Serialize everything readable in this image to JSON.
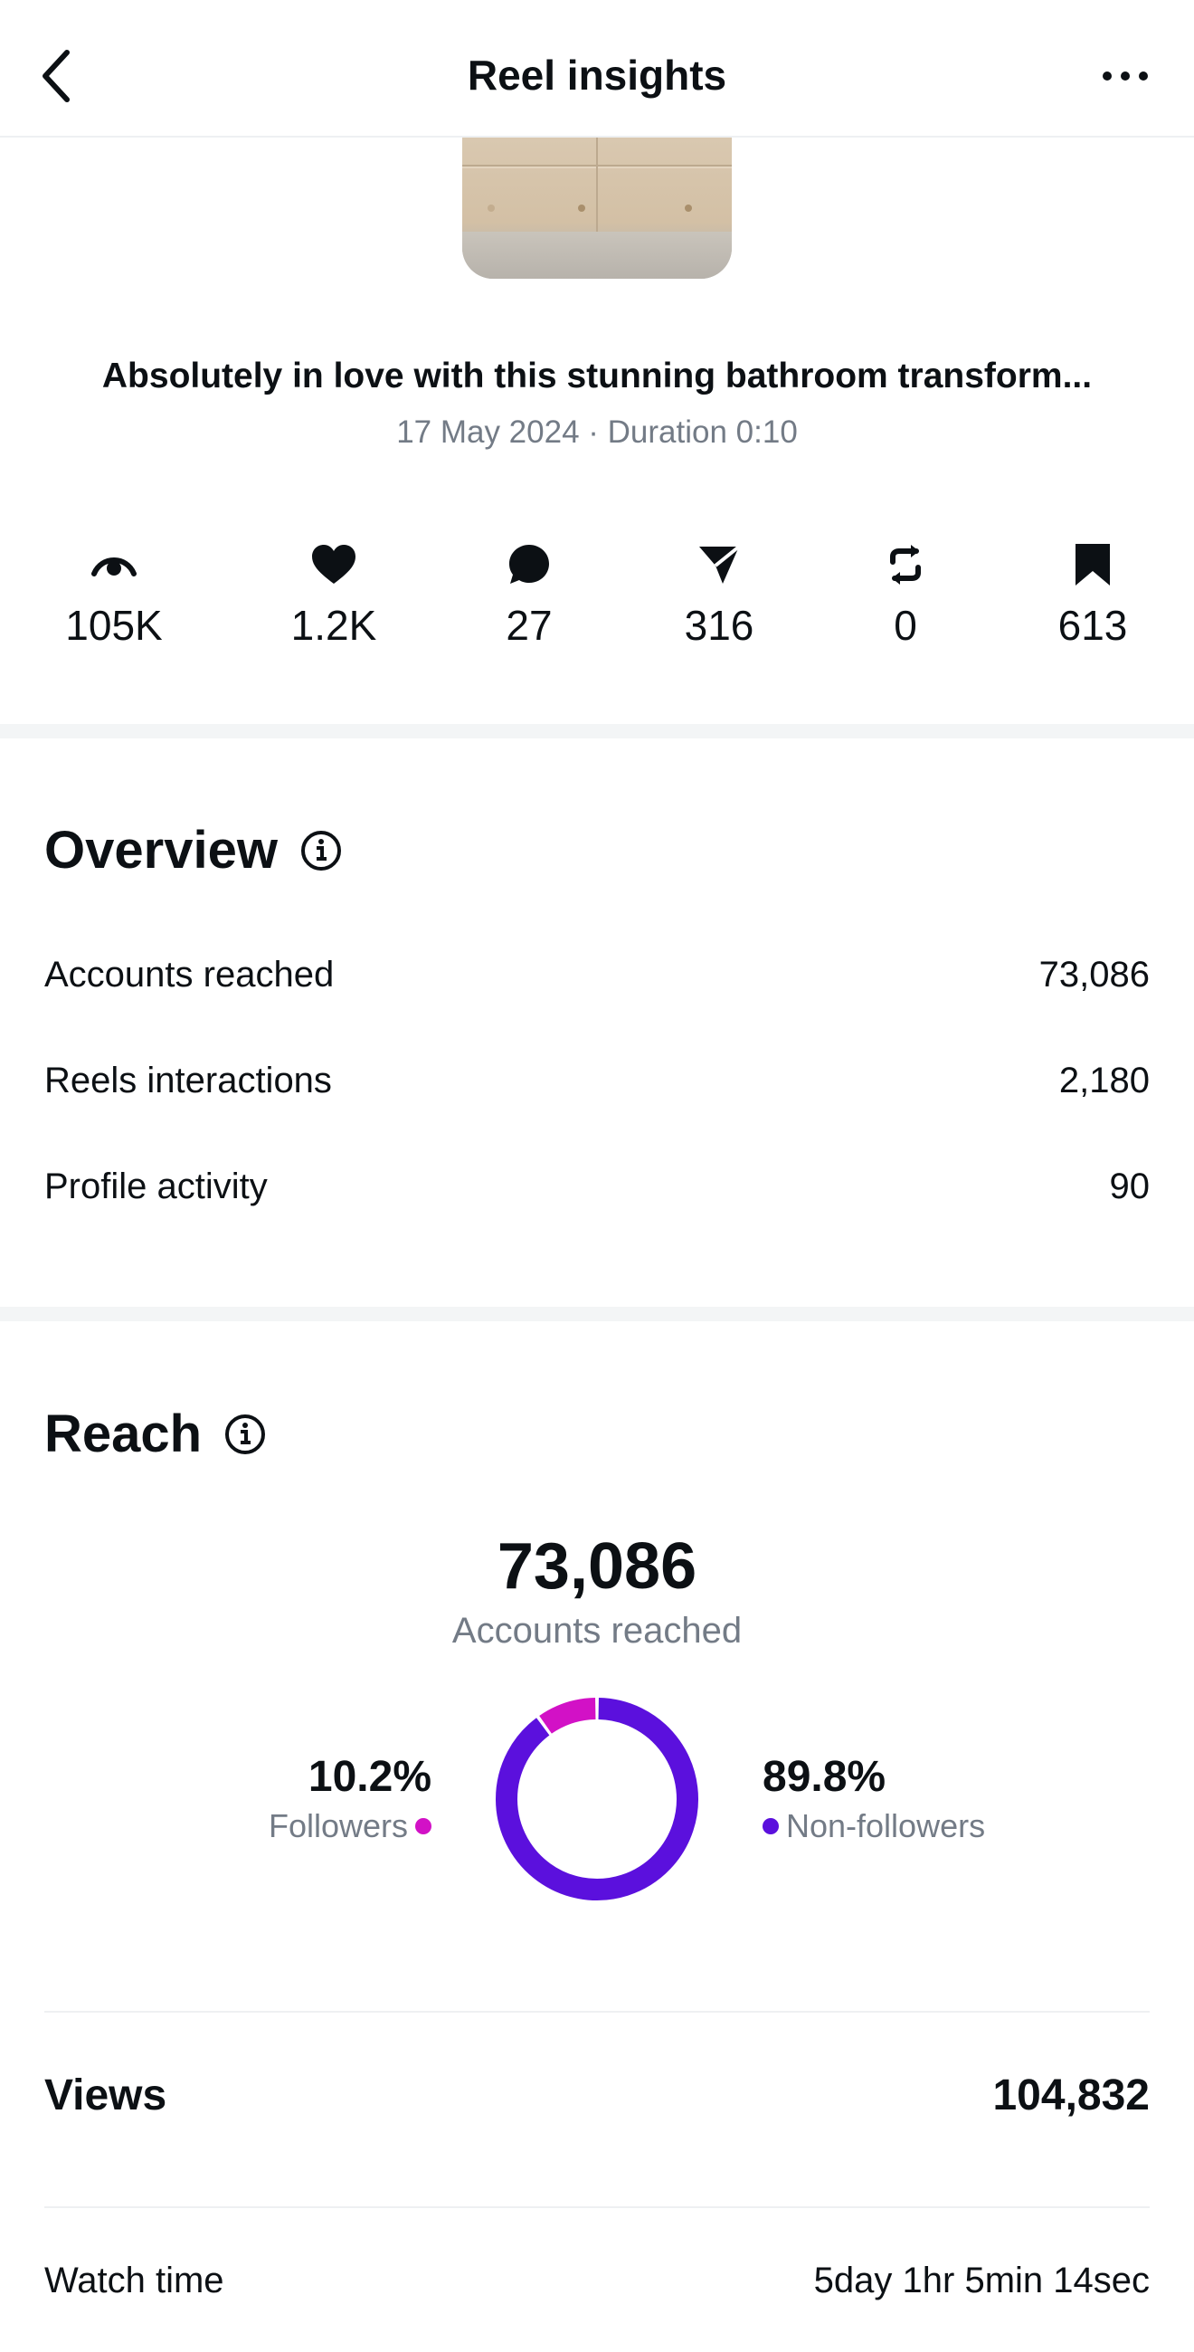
{
  "header": {
    "title": "Reel insights",
    "back_icon": "chevron-left-icon",
    "more_icon": "more-horizontal-icon"
  },
  "reel": {
    "caption": "Absolutely in love with this stunning bathroom transform...",
    "meta": "17 May 2024 · Duration 0:10"
  },
  "stats": [
    {
      "icon": "eye-icon",
      "value": "105K"
    },
    {
      "icon": "heart-icon",
      "value": "1.2K"
    },
    {
      "icon": "comment-icon",
      "value": "27"
    },
    {
      "icon": "share-icon",
      "value": "316"
    },
    {
      "icon": "repost-icon",
      "value": "0"
    },
    {
      "icon": "bookmark-icon",
      "value": "613"
    }
  ],
  "overview": {
    "title": "Overview",
    "rows": [
      {
        "label": "Accounts reached",
        "value": "73,086"
      },
      {
        "label": "Reels interactions",
        "value": "2,180"
      },
      {
        "label": "Profile activity",
        "value": "90"
      }
    ]
  },
  "reach": {
    "title": "Reach",
    "total": "73,086",
    "total_label": "Accounts reached",
    "followers_pct": "10.2%",
    "followers_label": "Followers",
    "non_followers_pct": "89.8%",
    "non_followers_label": "Non-followers",
    "followers_fraction": 0.102,
    "non_followers_fraction": 0.898,
    "followers_color": "#d211c6",
    "non_followers_color": "#5b10dd"
  },
  "views": {
    "label": "Views",
    "value": "104,832"
  },
  "watch_time": {
    "label": "Watch time",
    "value": "5day 1hr 5min 14sec"
  }
}
